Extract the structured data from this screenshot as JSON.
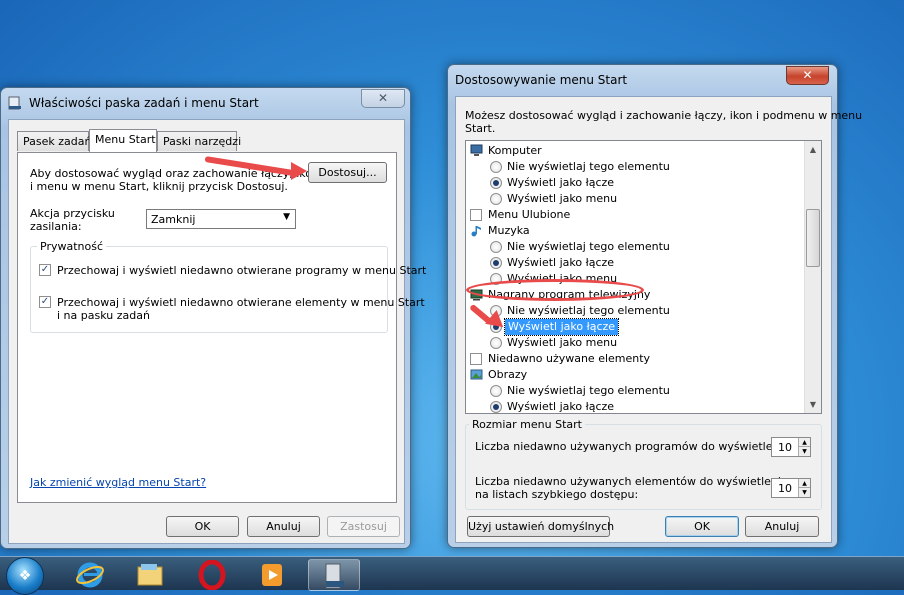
{
  "left_dialog": {
    "title": "Właściwości paska zadań i menu Start",
    "tabs": [
      "Pasek zadań",
      "Menu Start",
      "Paski narzędzi"
    ],
    "description": [
      "Aby dostosować wygląd oraz zachowanie łączy, ikon",
      "i menu w menu Start, kliknij przycisk Dostosuj."
    ],
    "customize_button": "Dostosuj...",
    "power_label": [
      "Akcja przycisku",
      "zasilania:"
    ],
    "power_value": "Zamknij",
    "privacy_group": "Prywatność",
    "privacy_items": [
      [
        "Przechowaj i wyświetl niedawno otwierane programy w menu Start"
      ],
      [
        "Przechowaj i wyświetl niedawno otwierane elementy w menu Start",
        "i na pasku zadań"
      ]
    ],
    "help_link": "Jak zmienić wygląd menu Start?",
    "ok": "OK",
    "cancel": "Anuluj",
    "apply": "Zastosuj"
  },
  "right_dialog": {
    "title": "Dostosowywanie menu Start",
    "description": [
      "Możesz dostosować wygląd i zachowanie łączy, ikon i podmenu w menu",
      "Start."
    ],
    "list": [
      {
        "type": "header",
        "icon": "computer-icon",
        "label": "Komputer"
      },
      {
        "type": "radio",
        "label": "Nie wyświetlaj tego elementu",
        "checked": false
      },
      {
        "type": "radio",
        "label": "Wyświetl jako łącze",
        "checked": true
      },
      {
        "type": "radio",
        "label": "Wyświetl jako menu",
        "checked": false
      },
      {
        "type": "checkbox",
        "label": "Menu Ulubione",
        "checked": false
      },
      {
        "type": "header",
        "icon": "music-icon",
        "label": "Muzyka"
      },
      {
        "type": "radio",
        "label": "Nie wyświetlaj tego elementu",
        "checked": false
      },
      {
        "type": "radio",
        "label": "Wyświetl jako łącze",
        "checked": true
      },
      {
        "type": "radio",
        "label": "Wyświetl jako menu",
        "checked": false
      },
      {
        "type": "header",
        "icon": "tv-icon",
        "label": "Nagrany program telewizyjny"
      },
      {
        "type": "radio",
        "label": "Nie wyświetlaj tego elementu",
        "checked": false
      },
      {
        "type": "radio",
        "label": "Wyświetl jako łącze",
        "checked": true,
        "selected": true
      },
      {
        "type": "radio",
        "label": "Wyświetl jako menu",
        "checked": false
      },
      {
        "type": "checkbox",
        "label": "Niedawno używane elementy",
        "checked": false
      },
      {
        "type": "header",
        "icon": "pictures-icon",
        "label": "Obrazy"
      },
      {
        "type": "radio",
        "label": "Nie wyświetlaj tego elementu",
        "checked": false
      },
      {
        "type": "radio",
        "label": "Wyświetl jako łącze",
        "checked": true
      }
    ],
    "size_group": "Rozmiar menu Start",
    "recent_programs_label": "Liczba niedawno używanych programów do wyświetlenia:",
    "recent_programs_value": "10",
    "recent_items_label": [
      "Liczba niedawno używanych elementów do wyświetlenia",
      "na listach szybkiego dostępu:"
    ],
    "recent_items_value": "10",
    "defaults_button": "Użyj ustawień domyślnych",
    "ok": "OK",
    "cancel": "Anuluj"
  },
  "colors": {
    "annotation": "#e94a4a",
    "selection": "#3399ff"
  }
}
